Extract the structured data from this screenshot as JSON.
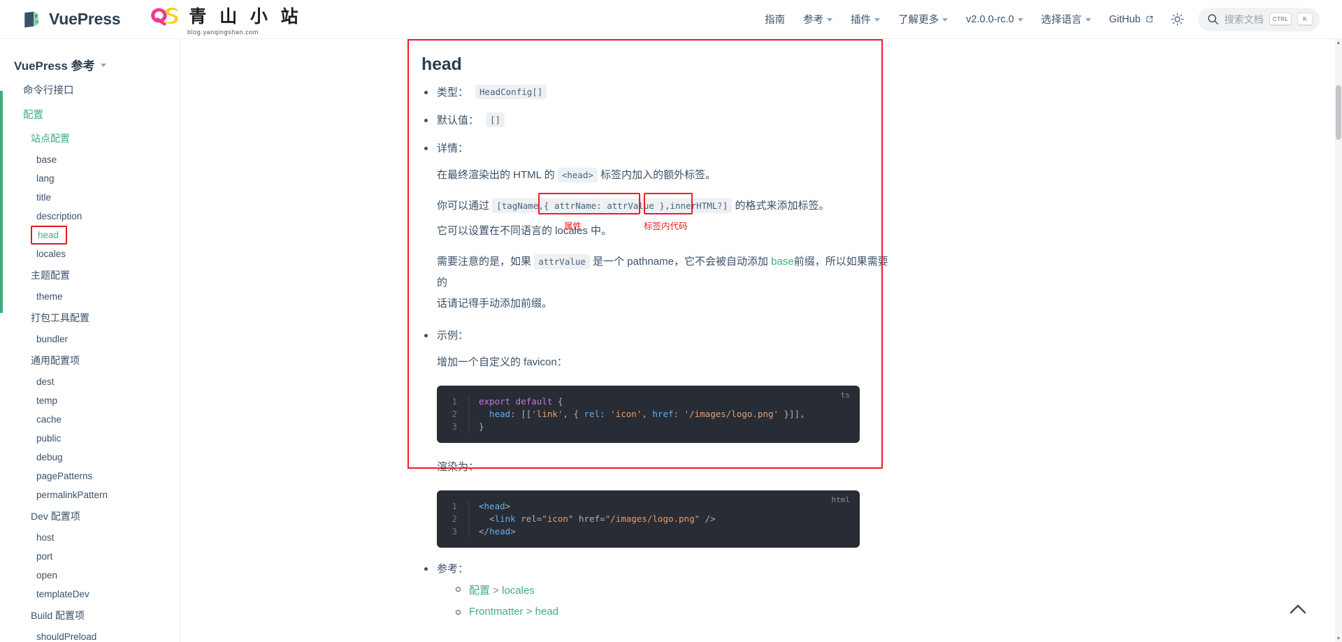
{
  "navbar": {
    "brand": "VuePress",
    "site_logo_cn": "青 山 小 站",
    "site_logo_sub": "blog.yanqingshan.com",
    "site_logo_mark": "QS",
    "items": [
      {
        "label": "指南",
        "caret": false
      },
      {
        "label": "参考",
        "caret": true
      },
      {
        "label": "插件",
        "caret": true
      },
      {
        "label": "了解更多",
        "caret": true
      },
      {
        "label": "v2.0.0-rc.0",
        "caret": true
      },
      {
        "label": "选择语言",
        "caret": true
      },
      {
        "label": "GitHub",
        "caret": false,
        "external": true
      }
    ],
    "theme_toggle_icon": "sun-icon",
    "search": {
      "placeholder": "搜索文档",
      "icon": "search-icon",
      "key_modifier": "CTRL",
      "key_letter": "K"
    }
  },
  "sidebar": {
    "title": "VuePress 参考",
    "items": [
      {
        "label": "命令行接口",
        "level": "group",
        "active": false
      },
      {
        "label": "配置",
        "level": "group",
        "active": true
      },
      {
        "label": "站点配置",
        "level": "sub",
        "active": true
      },
      {
        "label": "base",
        "level": "leaf",
        "active": false
      },
      {
        "label": "lang",
        "level": "leaf",
        "active": false
      },
      {
        "label": "title",
        "level": "leaf",
        "active": false
      },
      {
        "label": "description",
        "level": "leaf",
        "active": false
      },
      {
        "label": "head",
        "level": "leaf",
        "active": true,
        "boxed": true
      },
      {
        "label": "locales",
        "level": "leaf",
        "active": false
      },
      {
        "label": "主题配置",
        "level": "sub",
        "active": false
      },
      {
        "label": "theme",
        "level": "leaf",
        "active": false
      },
      {
        "label": "打包工具配置",
        "level": "sub",
        "active": false
      },
      {
        "label": "bundler",
        "level": "leaf",
        "active": false
      },
      {
        "label": "通用配置项",
        "level": "sub",
        "active": false
      },
      {
        "label": "dest",
        "level": "leaf",
        "active": false
      },
      {
        "label": "temp",
        "level": "leaf",
        "active": false
      },
      {
        "label": "cache",
        "level": "leaf",
        "active": false
      },
      {
        "label": "public",
        "level": "leaf",
        "active": false
      },
      {
        "label": "debug",
        "level": "leaf",
        "active": false
      },
      {
        "label": "pagePatterns",
        "level": "leaf",
        "active": false
      },
      {
        "label": "permalinkPattern",
        "level": "leaf",
        "active": false
      },
      {
        "label": "Dev 配置项",
        "level": "sub",
        "active": false
      },
      {
        "label": "host",
        "level": "leaf",
        "active": false
      },
      {
        "label": "port",
        "level": "leaf",
        "active": false
      },
      {
        "label": "open",
        "level": "leaf",
        "active": false
      },
      {
        "label": "templateDev",
        "level": "leaf",
        "active": false
      },
      {
        "label": "Build 配置项",
        "level": "sub",
        "active": false
      },
      {
        "label": "shouldPreload",
        "level": "leaf",
        "active": false
      }
    ]
  },
  "page": {
    "title": "head",
    "type_label": "类型：",
    "type_value": "HeadConfig[]",
    "default_label": "默认值：",
    "default_value": "[]",
    "details_label": "详情：",
    "detail_p1_a": "在最终渲染出的 HTML 的",
    "detail_p1_code": "<head>",
    "detail_p1_b": "标签内加入的额外标签。",
    "detail_p2_a": "你可以通过",
    "detail_p2_code_1": "[tagName,",
    "detail_p2_code_2": "{ attrName: attrValue }",
    "detail_p2_code_3": ",",
    "detail_p2_code_4": "innerHTML?",
    "detail_p2_code_5": "]",
    "detail_p2_b": "的格式来添加标签。",
    "annotation_attr": "属性",
    "annotation_inner": "标签内代码",
    "detail_p3": "它可以设置在不同语言的 locales 中。",
    "detail_p4_a": "需要注意的是，如果",
    "detail_p4_code": "attrValue",
    "detail_p4_b": "是一个 pathname，它不会被自动添加",
    "detail_p4_link": "base",
    "detail_p4_c": "前缀，所以如果需要的",
    "detail_p4_d": "话请记得手动添加前缀。",
    "example_label": "示例：",
    "example_intro": "增加一个自定义的 favicon：",
    "code_ts": {
      "lang": "ts",
      "lines": [
        {
          "n": "1",
          "tokens": [
            {
              "t": "export default ",
              "c": "t-kw"
            },
            {
              "t": "{",
              "c": "t-pun"
            }
          ]
        },
        {
          "n": "2",
          "tokens": [
            {
              "t": "  head",
              "c": "t-prop"
            },
            {
              "t": ": [[",
              "c": "t-pun"
            },
            {
              "t": "'link'",
              "c": "t-str"
            },
            {
              "t": ", { ",
              "c": "t-pun"
            },
            {
              "t": "rel",
              "c": "t-prop"
            },
            {
              "t": ": ",
              "c": "t-pun"
            },
            {
              "t": "'icon'",
              "c": "t-str"
            },
            {
              "t": ", ",
              "c": "t-pun"
            },
            {
              "t": "href",
              "c": "t-prop"
            },
            {
              "t": ": ",
              "c": "t-pun"
            },
            {
              "t": "'/images/logo.png'",
              "c": "t-str"
            },
            {
              "t": " }]],",
              "c": "t-pun"
            }
          ]
        },
        {
          "n": "3",
          "tokens": [
            {
              "t": "}",
              "c": "t-pun"
            }
          ]
        }
      ]
    },
    "render_label": "渲染为：",
    "code_html": {
      "lang": "html",
      "lines": [
        {
          "n": "1",
          "tokens": [
            {
              "t": "<",
              "c": "t-br"
            },
            {
              "t": "head",
              "c": "t-prop"
            },
            {
              "t": ">",
              "c": "t-br"
            }
          ]
        },
        {
          "n": "2",
          "tokens": [
            {
              "t": "  <",
              "c": "t-br"
            },
            {
              "t": "link",
              "c": "t-prop"
            },
            {
              "t": " rel",
              "c": "t-pun"
            },
            {
              "t": "=",
              "c": "t-br"
            },
            {
              "t": "\"icon\"",
              "c": "t-str"
            },
            {
              "t": " href",
              "c": "t-pun"
            },
            {
              "t": "=",
              "c": "t-br"
            },
            {
              "t": "\"/images/logo.png\"",
              "c": "t-str"
            },
            {
              "t": " />",
              "c": "t-br"
            }
          ]
        },
        {
          "n": "3",
          "tokens": [
            {
              "t": "</",
              "c": "t-br"
            },
            {
              "t": "head",
              "c": "t-prop"
            },
            {
              "t": ">",
              "c": "t-br"
            }
          ]
        }
      ]
    },
    "refs_label": "参考：",
    "refs": [
      {
        "link": "配置",
        "sep": " > ",
        "tail": "locales"
      },
      {
        "link": "Frontmatter",
        "sep": " > ",
        "tail": "head"
      }
    ]
  },
  "colors": {
    "accent": "#3eaf7c",
    "annotation_red": "#ee1c25",
    "text": "#3a5169",
    "code_bg": "#282c34"
  },
  "back_to_top_icon": "chevron-up-icon"
}
